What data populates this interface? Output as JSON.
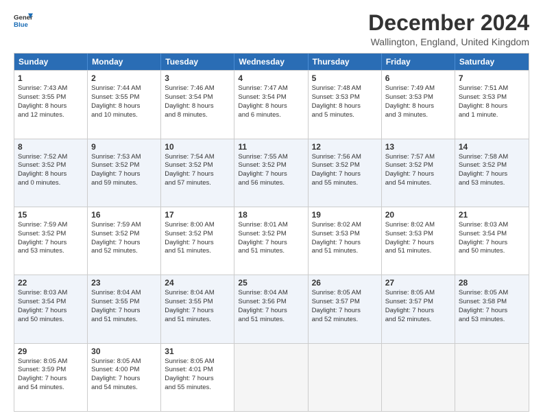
{
  "header": {
    "logo_line1": "General",
    "logo_line2": "Blue",
    "title": "December 2024",
    "subtitle": "Wallington, England, United Kingdom"
  },
  "days": [
    "Sunday",
    "Monday",
    "Tuesday",
    "Wednesday",
    "Thursday",
    "Friday",
    "Saturday"
  ],
  "rows": [
    [
      {
        "num": "",
        "lines": [],
        "empty": true
      },
      {
        "num": "2",
        "lines": [
          "Sunrise: 7:44 AM",
          "Sunset: 3:55 PM",
          "Daylight: 8 hours",
          "and 10 minutes."
        ]
      },
      {
        "num": "3",
        "lines": [
          "Sunrise: 7:46 AM",
          "Sunset: 3:54 PM",
          "Daylight: 8 hours",
          "and 8 minutes."
        ]
      },
      {
        "num": "4",
        "lines": [
          "Sunrise: 7:47 AM",
          "Sunset: 3:54 PM",
          "Daylight: 8 hours",
          "and 6 minutes."
        ]
      },
      {
        "num": "5",
        "lines": [
          "Sunrise: 7:48 AM",
          "Sunset: 3:53 PM",
          "Daylight: 8 hours",
          "and 5 minutes."
        ]
      },
      {
        "num": "6",
        "lines": [
          "Sunrise: 7:49 AM",
          "Sunset: 3:53 PM",
          "Daylight: 8 hours",
          "and 3 minutes."
        ]
      },
      {
        "num": "7",
        "lines": [
          "Sunrise: 7:51 AM",
          "Sunset: 3:53 PM",
          "Daylight: 8 hours",
          "and 1 minute."
        ]
      }
    ],
    [
      {
        "num": "8",
        "lines": [
          "Sunrise: 7:52 AM",
          "Sunset: 3:52 PM",
          "Daylight: 8 hours",
          "and 0 minutes."
        ]
      },
      {
        "num": "9",
        "lines": [
          "Sunrise: 7:53 AM",
          "Sunset: 3:52 PM",
          "Daylight: 7 hours",
          "and 59 minutes."
        ]
      },
      {
        "num": "10",
        "lines": [
          "Sunrise: 7:54 AM",
          "Sunset: 3:52 PM",
          "Daylight: 7 hours",
          "and 57 minutes."
        ]
      },
      {
        "num": "11",
        "lines": [
          "Sunrise: 7:55 AM",
          "Sunset: 3:52 PM",
          "Daylight: 7 hours",
          "and 56 minutes."
        ]
      },
      {
        "num": "12",
        "lines": [
          "Sunrise: 7:56 AM",
          "Sunset: 3:52 PM",
          "Daylight: 7 hours",
          "and 55 minutes."
        ]
      },
      {
        "num": "13",
        "lines": [
          "Sunrise: 7:57 AM",
          "Sunset: 3:52 PM",
          "Daylight: 7 hours",
          "and 54 minutes."
        ]
      },
      {
        "num": "14",
        "lines": [
          "Sunrise: 7:58 AM",
          "Sunset: 3:52 PM",
          "Daylight: 7 hours",
          "and 53 minutes."
        ]
      }
    ],
    [
      {
        "num": "15",
        "lines": [
          "Sunrise: 7:59 AM",
          "Sunset: 3:52 PM",
          "Daylight: 7 hours",
          "and 53 minutes."
        ]
      },
      {
        "num": "16",
        "lines": [
          "Sunrise: 7:59 AM",
          "Sunset: 3:52 PM",
          "Daylight: 7 hours",
          "and 52 minutes."
        ]
      },
      {
        "num": "17",
        "lines": [
          "Sunrise: 8:00 AM",
          "Sunset: 3:52 PM",
          "Daylight: 7 hours",
          "and 51 minutes."
        ]
      },
      {
        "num": "18",
        "lines": [
          "Sunrise: 8:01 AM",
          "Sunset: 3:52 PM",
          "Daylight: 7 hours",
          "and 51 minutes."
        ]
      },
      {
        "num": "19",
        "lines": [
          "Sunrise: 8:02 AM",
          "Sunset: 3:53 PM",
          "Daylight: 7 hours",
          "and 51 minutes."
        ]
      },
      {
        "num": "20",
        "lines": [
          "Sunrise: 8:02 AM",
          "Sunset: 3:53 PM",
          "Daylight: 7 hours",
          "and 51 minutes."
        ]
      },
      {
        "num": "21",
        "lines": [
          "Sunrise: 8:03 AM",
          "Sunset: 3:54 PM",
          "Daylight: 7 hours",
          "and 50 minutes."
        ]
      }
    ],
    [
      {
        "num": "22",
        "lines": [
          "Sunrise: 8:03 AM",
          "Sunset: 3:54 PM",
          "Daylight: 7 hours",
          "and 50 minutes."
        ]
      },
      {
        "num": "23",
        "lines": [
          "Sunrise: 8:04 AM",
          "Sunset: 3:55 PM",
          "Daylight: 7 hours",
          "and 51 minutes."
        ]
      },
      {
        "num": "24",
        "lines": [
          "Sunrise: 8:04 AM",
          "Sunset: 3:55 PM",
          "Daylight: 7 hours",
          "and 51 minutes."
        ]
      },
      {
        "num": "25",
        "lines": [
          "Sunrise: 8:04 AM",
          "Sunset: 3:56 PM",
          "Daylight: 7 hours",
          "and 51 minutes."
        ]
      },
      {
        "num": "26",
        "lines": [
          "Sunrise: 8:05 AM",
          "Sunset: 3:57 PM",
          "Daylight: 7 hours",
          "and 52 minutes."
        ]
      },
      {
        "num": "27",
        "lines": [
          "Sunrise: 8:05 AM",
          "Sunset: 3:57 PM",
          "Daylight: 7 hours",
          "and 52 minutes."
        ]
      },
      {
        "num": "28",
        "lines": [
          "Sunrise: 8:05 AM",
          "Sunset: 3:58 PM",
          "Daylight: 7 hours",
          "and 53 minutes."
        ]
      }
    ],
    [
      {
        "num": "29",
        "lines": [
          "Sunrise: 8:05 AM",
          "Sunset: 3:59 PM",
          "Daylight: 7 hours",
          "and 54 minutes."
        ]
      },
      {
        "num": "30",
        "lines": [
          "Sunrise: 8:05 AM",
          "Sunset: 4:00 PM",
          "Daylight: 7 hours",
          "and 54 minutes."
        ]
      },
      {
        "num": "31",
        "lines": [
          "Sunrise: 8:05 AM",
          "Sunset: 4:01 PM",
          "Daylight: 7 hours",
          "and 55 minutes."
        ]
      },
      {
        "num": "",
        "lines": [],
        "empty": true
      },
      {
        "num": "",
        "lines": [],
        "empty": true
      },
      {
        "num": "",
        "lines": [],
        "empty": true
      },
      {
        "num": "",
        "lines": [],
        "empty": true
      }
    ]
  ],
  "row1_special": [
    {
      "num": "1",
      "lines": [
        "Sunrise: 7:43 AM",
        "Sunset: 3:55 PM",
        "Daylight: 8 hours",
        "and 12 minutes."
      ]
    }
  ]
}
